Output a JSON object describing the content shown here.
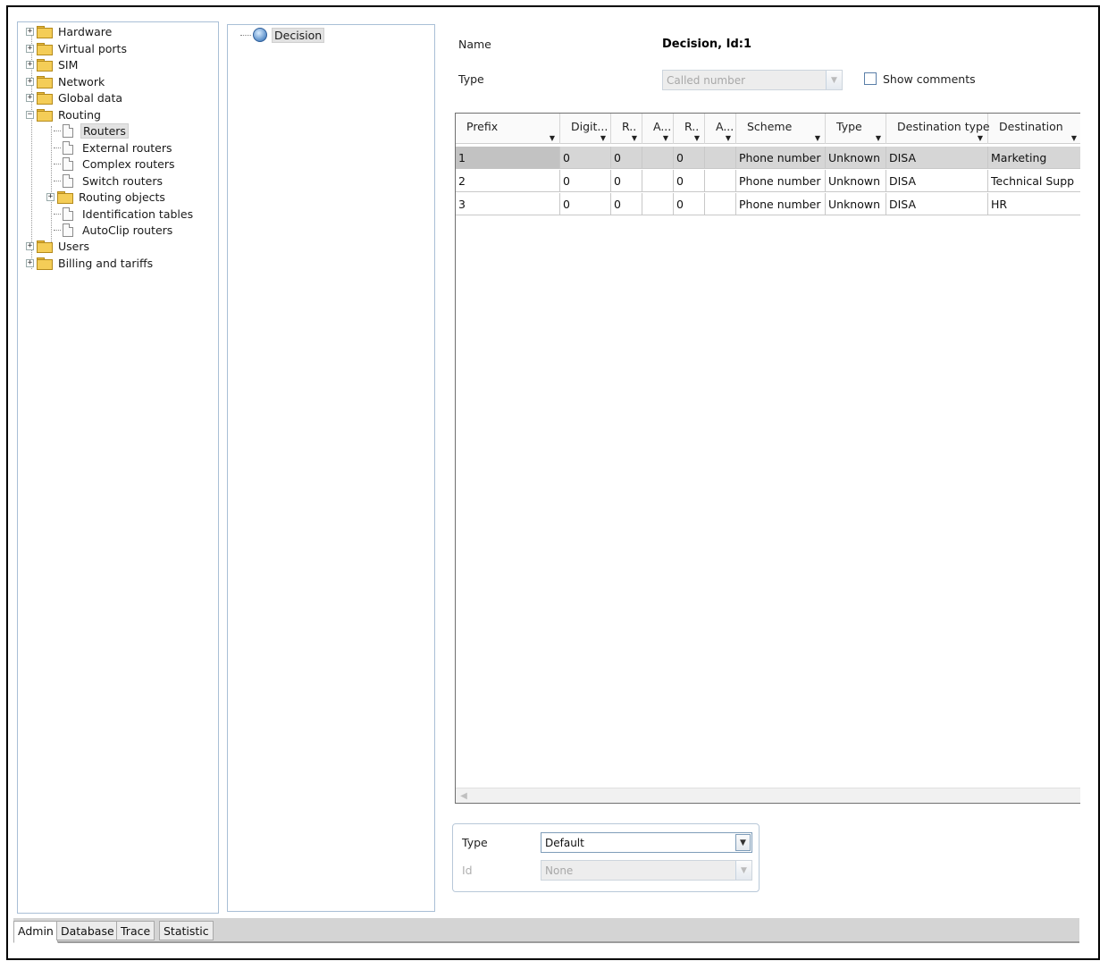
{
  "tree": {
    "items": [
      {
        "label": "Hardware",
        "type": "folder",
        "expander": "+"
      },
      {
        "label": "Virtual ports",
        "type": "folder",
        "expander": "+"
      },
      {
        "label": "SIM",
        "type": "folder",
        "expander": "+"
      },
      {
        "label": "Network",
        "type": "folder",
        "expander": "+"
      },
      {
        "label": "Global data",
        "type": "folder",
        "expander": "+"
      },
      {
        "label": "Routing",
        "type": "folder-open",
        "expander": "−"
      },
      {
        "label": "Routers",
        "type": "document",
        "selected": true
      },
      {
        "label": "External routers",
        "type": "document"
      },
      {
        "label": "Complex routers",
        "type": "document"
      },
      {
        "label": "Switch routers",
        "type": "document"
      },
      {
        "label": "Routing objects",
        "type": "folder",
        "expander": "+"
      },
      {
        "label": "Identification tables",
        "type": "document"
      },
      {
        "label": "AutoClip routers",
        "type": "document"
      },
      {
        "label": "Users",
        "type": "folder",
        "expander": "+"
      },
      {
        "label": "Billing and tariffs",
        "type": "folder",
        "expander": "+"
      }
    ]
  },
  "objects": {
    "items": [
      {
        "label": "Decision",
        "icon": "globe-icon"
      }
    ]
  },
  "details": {
    "name_label": "Name",
    "name_value": "Decision, Id:1",
    "type_label": "Type",
    "type_value": "Called number",
    "show_comments_label": "Show comments",
    "show_comments_checked": false
  },
  "grid": {
    "columns": [
      "Prefix",
      "Digit...",
      "R..",
      "A...",
      "R..",
      "A...",
      "Scheme",
      "Type",
      "Destination type",
      "Destination"
    ],
    "rows": [
      [
        "1",
        "0",
        "0",
        "",
        "0",
        "",
        "Phone number",
        "Unknown",
        "DISA",
        "Marketing"
      ],
      [
        "2",
        "0",
        "0",
        "",
        "0",
        "",
        "Phone number",
        "Unknown",
        "DISA",
        "Technical Supp"
      ],
      [
        "3",
        "0",
        "0",
        "",
        "0",
        "",
        "Phone number",
        "Unknown",
        "DISA",
        "HR"
      ]
    ],
    "selected_row": 0
  },
  "default_box": {
    "type_label": "Type",
    "type_value": "Default",
    "id_label": "Id",
    "id_value": "None"
  },
  "tabs": [
    {
      "label": "Admin",
      "active": true
    },
    {
      "label": "Database",
      "active": false
    },
    {
      "label": "Trace",
      "active": false
    },
    {
      "label": "Statistic",
      "active": false
    }
  ],
  "icons": {
    "expander": "plus-minus-box-icon",
    "folder": "folder-icon",
    "document": "document-icon",
    "globe": "globe-icon",
    "dropdown": "chevron-down-icon",
    "filter": "filter-arrow-icon",
    "scroll_left": "scroll-left-icon"
  },
  "colors": {
    "folder": "#f4cd57",
    "selected_row": "#d6d6d6",
    "panel_border": "#a9bfd6",
    "status_bar": "#d4d4d4"
  }
}
